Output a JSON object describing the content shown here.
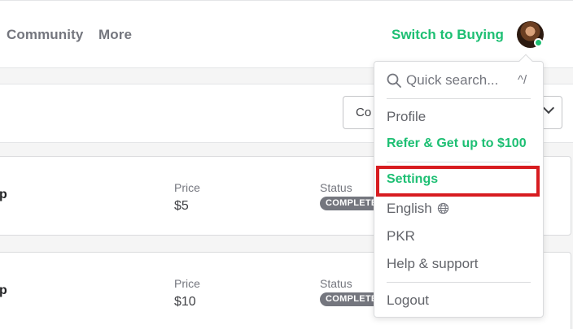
{
  "header": {
    "nav_links": [
      "Community",
      "More"
    ],
    "switch_label": "Switch to Buying",
    "avatar_icon": "user-avatar",
    "online_color": "#1dbf73"
  },
  "filter": {
    "selected_value": "Co"
  },
  "orders": [
    {
      "title_fragment": "p",
      "price_label": "Price",
      "price": "$5",
      "status_label": "Status",
      "status": "COMPLETED"
    },
    {
      "title_fragment": "p",
      "price_label": "Price",
      "price": "$10",
      "status_label": "Status",
      "status": "COMPLETED"
    }
  ],
  "menu": {
    "search_placeholder": "Quick search...",
    "search_shortcut": "^/",
    "items": [
      {
        "label": "Profile"
      },
      {
        "label": "Refer & Get up to $100"
      },
      {
        "label": "Settings"
      },
      {
        "label": "English"
      },
      {
        "label": "PKR"
      },
      {
        "label": "Help & support"
      },
      {
        "label": "Logout"
      }
    ]
  },
  "colors": {
    "accent_green": "#1dbf73",
    "highlight_red": "#d71c20",
    "badge_gray": "#74767e"
  }
}
